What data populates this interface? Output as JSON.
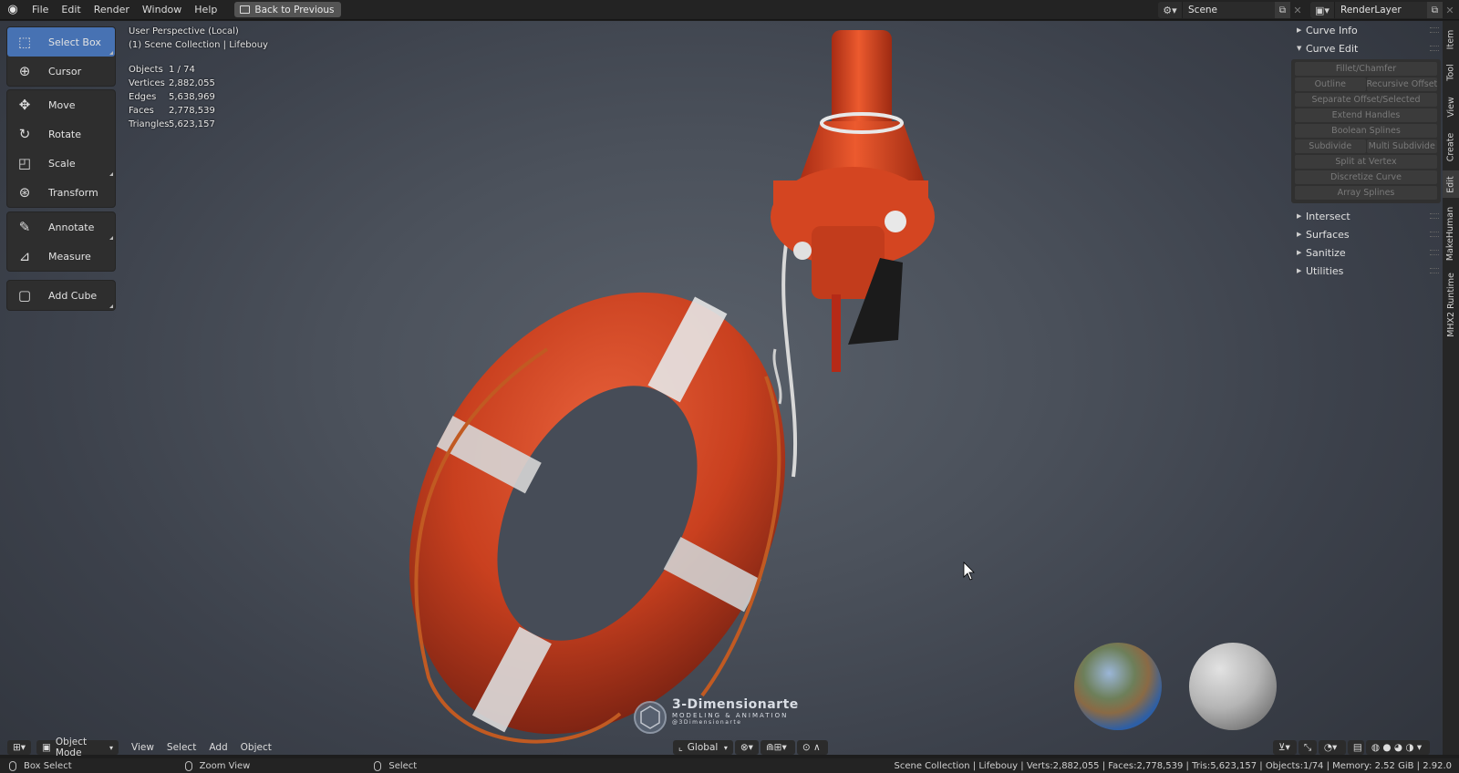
{
  "topbar": {
    "menus": [
      "File",
      "Edit",
      "Render",
      "Window",
      "Help"
    ],
    "back_label": "Back to Previous",
    "scene": "Scene",
    "render_layer": "RenderLayer"
  },
  "toolbar": {
    "select_box": "Select Box",
    "cursor": "Cursor",
    "move": "Move",
    "rotate": "Rotate",
    "scale": "Scale",
    "transform": "Transform",
    "annotate": "Annotate",
    "measure": "Measure",
    "add_cube": "Add Cube"
  },
  "overlay": {
    "perspective": "User Perspective (Local)",
    "collection": "(1) Scene Collection | Lifebouy"
  },
  "stats": [
    {
      "key": "Objects",
      "value": "1 / 74"
    },
    {
      "key": "Vertices",
      "value": "2,882,055"
    },
    {
      "key": "Edges",
      "value": "5,638,969"
    },
    {
      "key": "Faces",
      "value": "2,778,539"
    },
    {
      "key": "Triangles",
      "value": "5,623,157"
    }
  ],
  "npanel": {
    "curve_info": "Curve Info",
    "curve_edit": "Curve Edit",
    "buttons": {
      "fillet": "Fillet/Chamfer",
      "outline": "Outline",
      "recursive_offset": "Recursive Offset",
      "separate_offset": "Separate Offset/Selected",
      "extend_handles": "Extend Handles",
      "boolean_splines": "Boolean Splines",
      "subdivide": "Subdivide",
      "multi_subdivide": "Multi Subdivide",
      "split_at_vertex": "Split at Vertex",
      "discretize_curve": "Discretize Curve",
      "array_splines": "Array Splines"
    },
    "intersect": "Intersect",
    "surfaces": "Surfaces",
    "sanitize": "Sanitize",
    "utilities": "Utilities"
  },
  "vtabs": {
    "item": "Item",
    "tool": "Tool",
    "view": "View",
    "create": "Create",
    "edit": "Edit",
    "makehuman": "MakeHuman",
    "mhx2": "MHX2 Runtime"
  },
  "watermark": {
    "title": "3-Dimensionarte",
    "subtitle": "MODELING & ANIMATION",
    "handle": "@3Dimensionarte"
  },
  "vp_header": {
    "mode": "Object Mode",
    "view": "View",
    "select": "Select",
    "add": "Add",
    "object": "Object",
    "orientation": "Global"
  },
  "statusbar": {
    "box_select": "Box Select",
    "zoom_view": "Zoom View",
    "select": "Select",
    "info": "Scene Collection | Lifebouy | Verts:2,882,055 | Faces:2,778,539 | Tris:5,623,157 | Objects:1/74 | Memory: 2.52 GiB | 2.92.0"
  },
  "colors": {
    "accent": "#4772b3",
    "buoy": "#d24a28"
  }
}
